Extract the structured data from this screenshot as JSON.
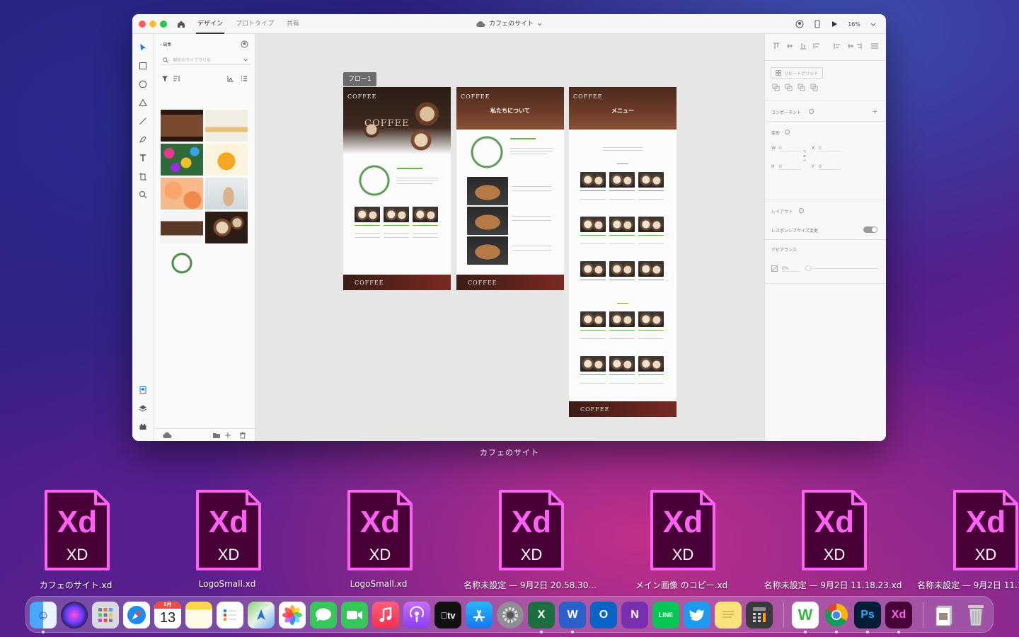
{
  "app": {
    "tabs": [
      "デザイン",
      "プロトタイプ",
      "共有"
    ],
    "active_tab": "デザイン",
    "document_title": "カフェのサイト",
    "zoom": "16%"
  },
  "library": {
    "back_label": "編集",
    "search_placeholder": "現在のライブラリを"
  },
  "canvas": {
    "flow_label": "フロー1",
    "artboards": [
      {
        "logo": "COFFEE",
        "title": "",
        "footer_logo": "COFFEE"
      },
      {
        "logo": "COFFEE",
        "title": "私たちについて",
        "footer_logo": "COFFEE"
      },
      {
        "logo": "COFFEE",
        "title": "メニュー",
        "footer_logo": "COFFEE"
      }
    ]
  },
  "properties": {
    "repeat_grid": "リピートグリッド",
    "component": "コンポーネント",
    "transform": "変形",
    "w_label": "W",
    "w_value": "0",
    "h_label": "H",
    "h_value": "0",
    "x_label": "X",
    "x_value": "0",
    "y_label": "Y",
    "y_value": "0",
    "layout": "レイアウト",
    "responsive": "レスポンシブサイズ変更",
    "appearance": "アピアランス",
    "opacity": "0%"
  },
  "window_caption": "カフェのサイト",
  "desktop_files": [
    {
      "name": "カフェのサイト.xd",
      "badge": "Xd",
      "type": "XD"
    },
    {
      "name": "LogoSmall.xd",
      "badge": "Xd",
      "type": "XD"
    },
    {
      "name": "LogoSmall.xd",
      "badge": "Xd",
      "type": "XD"
    },
    {
      "name": "名称未設定 — 9月2日 20.58.30...",
      "badge": "Xd",
      "type": "XD"
    },
    {
      "name": "メイン画像 のコピー.xd",
      "badge": "Xd",
      "type": "XD"
    },
    {
      "name": "名称未設定 — 9月2日 11.18.23.xd",
      "badge": "Xd",
      "type": "XD"
    },
    {
      "name": "名称未設定 — 9月2日 11.1",
      "badge": "Xd",
      "type": "XD"
    }
  ],
  "dock": {
    "calendar_month": "9月",
    "calendar_day": "13",
    "tv_label": "tv",
    "word_letter": "W",
    "onenote_letter": "N",
    "line_label": "LINE",
    "ps_label": "Ps",
    "xd_label": "Xd",
    "excel_letter": "X",
    "outlook_letter": "O",
    "wps_letter": "W"
  },
  "colors": {
    "xd_magenta": "#ff61f6",
    "xd_dark": "#470137",
    "accent_blue": "#1473e6"
  }
}
